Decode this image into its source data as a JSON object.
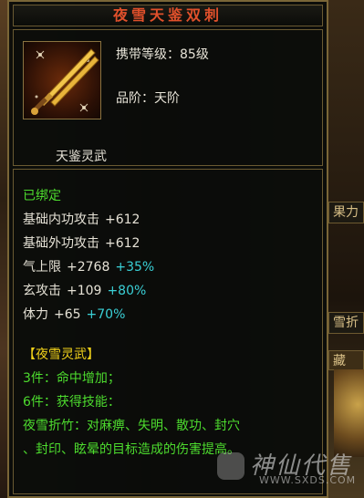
{
  "item": {
    "title": "夜雪天鉴双刺",
    "carry_level": "携带等级：85级",
    "grade": "品阶：天阶",
    "subtitle": "天鉴灵武"
  },
  "stats": {
    "bound": "已绑定",
    "lines": [
      {
        "name": "基础内功攻击",
        "base": "+612",
        "bonus": ""
      },
      {
        "name": "基础外功攻击",
        "base": "+612",
        "bonus": ""
      },
      {
        "name": "气上限",
        "base": "+2768",
        "bonus": "+35%"
      },
      {
        "name": "玄攻击",
        "base": "+109",
        "bonus": "+80%"
      },
      {
        "name": "体力",
        "base": "+65",
        "bonus": "+70%"
      }
    ]
  },
  "set": {
    "name": "【夜雪灵武】",
    "piece3": "3件：命中增加；",
    "piece6": "6件：获得技能：",
    "skill_line1": "夜雪折竹：对麻痹、失明、散功、封穴",
    "skill_line2": "、封印、眩晕的目标造成的伤害提高。"
  },
  "background": {
    "tab1": "果力",
    "tab2": "雪折",
    "tab3": "藏"
  },
  "watermark": {
    "title": "神仙代售",
    "url": "WWW.SXDS.COM"
  },
  "colors": {
    "title": "#e0502b",
    "bound_and_set": "#4ddc2e",
    "bonus": "#3ad0d6",
    "set_name": "#f2d21a",
    "frame": "#7a6637"
  },
  "icon": "twin-daggers-icon"
}
